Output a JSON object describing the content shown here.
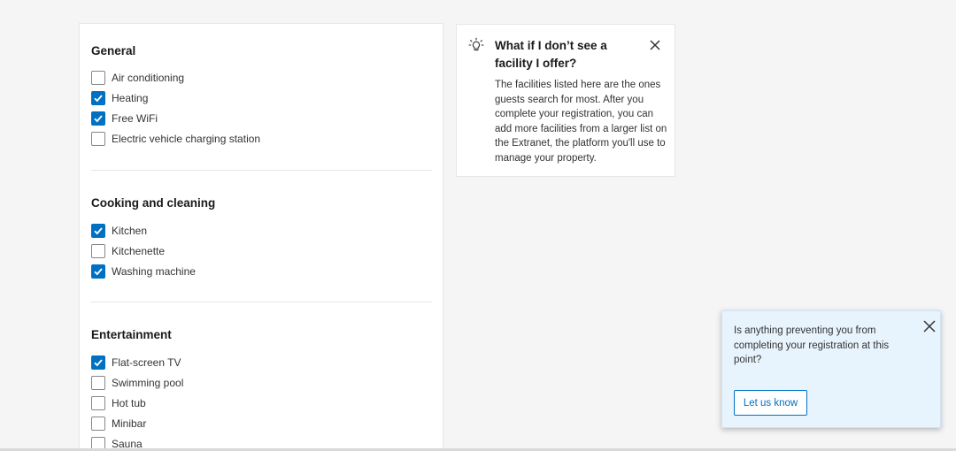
{
  "sections": [
    {
      "title": "General",
      "items": [
        {
          "label": "Air conditioning",
          "checked": false
        },
        {
          "label": "Heating",
          "checked": true
        },
        {
          "label": "Free WiFi",
          "checked": true
        },
        {
          "label": "Electric vehicle charging station",
          "checked": false
        }
      ]
    },
    {
      "title": "Cooking and cleaning",
      "items": [
        {
          "label": "Kitchen",
          "checked": true
        },
        {
          "label": "Kitchenette",
          "checked": false
        },
        {
          "label": "Washing machine",
          "checked": true
        }
      ]
    },
    {
      "title": "Entertainment",
      "items": [
        {
          "label": "Flat-screen TV",
          "checked": true
        },
        {
          "label": "Swimming pool",
          "checked": false
        },
        {
          "label": "Hot tub",
          "checked": false
        },
        {
          "label": "Minibar",
          "checked": false
        },
        {
          "label": "Sauna",
          "checked": false
        }
      ]
    }
  ],
  "info": {
    "title": "What if I don’t see a facility I offer?",
    "body": "The facilities listed here are the ones guests search for most. After you complete your registration, you can add more facilities from a larger list on the Extranet, the platform you'll use to manage your property.",
    "icon": "lightbulb-icon"
  },
  "feedback": {
    "text": "Is anything preventing you from completing your registration at this point?",
    "button": "Let us know"
  },
  "colors": {
    "accent": "#0071c2",
    "feedback_bg": "#e8f4fd"
  }
}
